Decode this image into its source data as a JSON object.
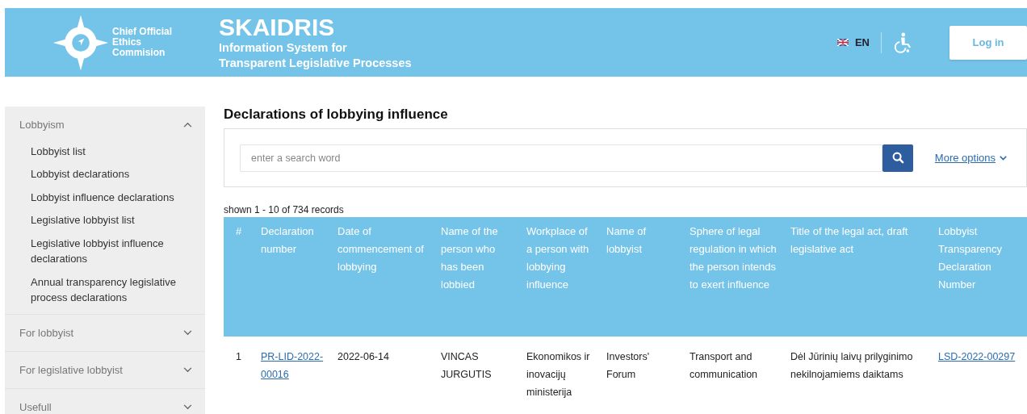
{
  "header": {
    "org_name": "Chief Official Ethics Commision",
    "title": "SKAIDRIS",
    "subtitle_lines": [
      "Information System for",
      "Transparent Legislative Processes"
    ],
    "language": "EN",
    "login_button": "Log in"
  },
  "sidebar": {
    "groups": [
      {
        "label": "Lobbyism",
        "expanded": true,
        "items": [
          "Lobbyist list",
          "Lobbyist declarations",
          "Lobbyist influence declarations",
          "Legislative lobbyist list",
          "Legislative lobbyist influence declarations",
          "Annual transparency legislative process declarations"
        ]
      },
      {
        "label": "For lobbyist",
        "expanded": false
      },
      {
        "label": "For legislative lobbyist",
        "expanded": false
      },
      {
        "label": "Usefull",
        "expanded": false
      }
    ]
  },
  "page_title": "Declarations of lobbying influence",
  "search": {
    "placeholder": "enter a search word",
    "more_options": "More options"
  },
  "records_info": "shown 1 - 10 of 734 records",
  "table": {
    "columns": [
      "#",
      "Declaration number",
      "Date of commencement of lobbying",
      "Name of the person who has been lobbied",
      "Workplace of a person with lobbying influence",
      "Name of lobbyist",
      "Sphere of legal regulation in which the person intends to exert influence",
      "Title of the legal act, draft legislative act",
      "Lobbyist Transparency Declaration Number"
    ],
    "rows": [
      {
        "cells": [
          {
            "kind": "text",
            "text": "1"
          },
          {
            "kind": "link",
            "text": "PR-LID-2022-00016"
          },
          {
            "kind": "text",
            "text": "2022-06-14"
          },
          {
            "kind": "text",
            "text": "VINCAS JURGUTIS"
          },
          {
            "kind": "text",
            "text": "Ekonomikos ir inovacijų ministerija"
          },
          {
            "kind": "text",
            "text": "Investors' Forum"
          },
          {
            "kind": "text",
            "text": "Transport and communication"
          },
          {
            "kind": "text",
            "text": "Dėl Jūrinių laivų prilyginimo nekilnojamiems daiktams"
          },
          {
            "kind": "link",
            "text": "LSD-2022-00297"
          }
        ]
      }
    ]
  }
}
